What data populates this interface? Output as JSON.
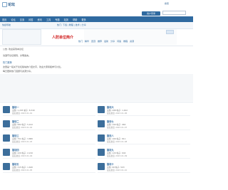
{
  "header": {
    "logo_text": "论坛",
    "signin_label": "用户登录",
    "search_label": "搜索"
  },
  "nav": {
    "items": [
      "首页",
      "论坛",
      "交流",
      "问答",
      "资讯",
      "工具",
      "专题",
      "站务",
      "帮助",
      "更多"
    ]
  },
  "subnav": {
    "left_text": "快捷导航",
    "right_text": "热门: 下载 | 教程 | 技术 | 分享"
  },
  "banner": {
    "title": "人防单位简介"
  },
  "tags": [
    "热门",
    "精华",
    "置顶",
    "推荐",
    "最新",
    "分享",
    "问答",
    "教程",
    "资源"
  ],
  "notice": {
    "line1": "公告: 欢迎来到本论坛",
    "line2": "请遵守论坛规则，文明发言。",
    "section_title": "热门推荐",
    "para1": "这里是一段关于论坛版块的介绍文字，欢迎大家积极参与讨论。",
    "para2": "每日更新热门话题与资源分享。"
  },
  "forum_left": [
    {
      "name": "版块一",
      "meta": "主题: 1,205  帖子: 8,340",
      "last": "最后发表 2023-01-01"
    },
    {
      "name": "版块二",
      "meta": "主题: 982  帖子: 5,102",
      "last": "最后发表 2023-01-02"
    },
    {
      "name": "版块三",
      "meta": "主题: 751  帖子: 3,880",
      "last": "最后发表 2023-01-03"
    },
    {
      "name": "版块四",
      "meta": "主题: 420  帖子: 2,210",
      "last": "最后发表 2023-01-04"
    },
    {
      "name": "版块五",
      "meta": "主题: 315  帖子: 1,640",
      "last": "最后发表 2023-01-05"
    }
  ],
  "forum_right": [
    {
      "name": "版块六",
      "meta": "主题: 288  帖子: 1,402",
      "last": "最后发表 2023-01-06"
    },
    {
      "name": "版块七",
      "meta": "主题: 199  帖子: 960",
      "last": "最后发表 2023-01-07"
    },
    {
      "name": "版块八",
      "meta": "主题: 166  帖子: 811",
      "last": "最后发表 2023-01-08"
    },
    {
      "name": "版块九",
      "meta": "主题: 120  帖子: 640",
      "last": "最后发表 2023-01-09"
    },
    {
      "name": "版块十",
      "meta": "主题: 98  帖子: 503",
      "last": "最后发表 2023-01-10"
    }
  ],
  "colors": {
    "nav": "#2f6aa0",
    "accent": "#d01c1c"
  }
}
